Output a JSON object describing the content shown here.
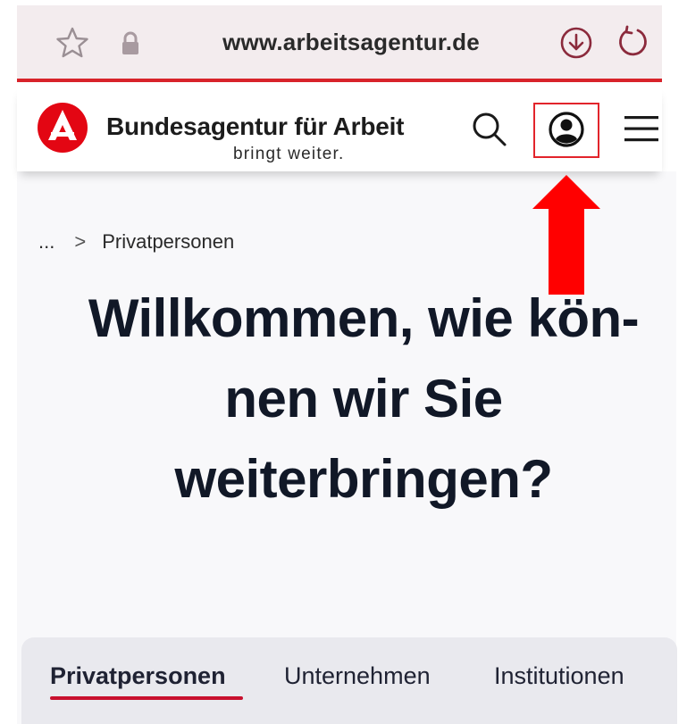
{
  "browser": {
    "url": "www.arbeitsagentur.de",
    "icons": [
      "star-icon",
      "lock-icon",
      "download-icon",
      "reload-icon"
    ]
  },
  "header": {
    "brand_name": "Bundesagentur für Arbeit",
    "tagline": "bringt weiter.",
    "icons": [
      "search-icon",
      "account-icon",
      "menu-icon"
    ],
    "accent_color": "#d8232a"
  },
  "breadcrumb": {
    "ellipsis": "...",
    "separator": ">",
    "current": "Privatpersonen"
  },
  "headline": {
    "line1": "Willkommen, wie kön-",
    "line2": "nen wir Sie",
    "line3": "weiterbringen?"
  },
  "tabs": [
    {
      "label": "Privatpersonen",
      "active": true
    },
    {
      "label": "Unternehmen",
      "active": false
    },
    {
      "label": "Institutionen",
      "active": false
    }
  ],
  "annotation": {
    "arrow_color": "#ff0000",
    "highlight_color": "#e2242b"
  }
}
